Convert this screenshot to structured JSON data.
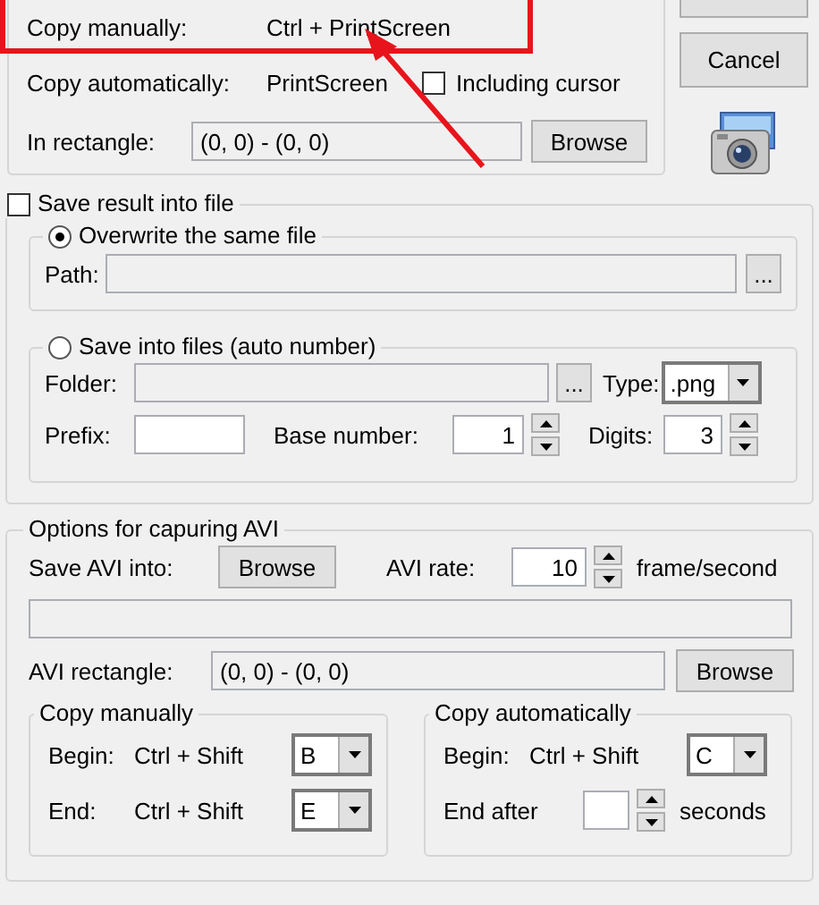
{
  "capture": {
    "copy_manually_label": "Copy manually:",
    "copy_manually_keys": "Ctrl + PrintScreen",
    "copy_auto_label": "Copy automatically:",
    "copy_auto_keys": "PrintScreen",
    "including_cursor": {
      "label": "Including cursor",
      "checked": false
    },
    "rectangle_label": "In rectangle:",
    "rectangle_value": "(0, 0) - (0, 0)",
    "browse": "Browse"
  },
  "cancel": "Cancel",
  "save_file": {
    "label": "Save result into file",
    "checked": false,
    "overwrite": {
      "label": "Overwrite the same file",
      "selected": true,
      "path_label": "Path:",
      "browse": "..."
    },
    "auto": {
      "label": "Save into files (auto number)",
      "selected": false,
      "folder_label": "Folder:",
      "browse": "...",
      "type_label": "Type:",
      "type_value": ".png",
      "prefix_label": "Prefix:",
      "base_label": "Base number:",
      "base_value": "1",
      "digits_label": "Digits:",
      "digits_value": "3"
    }
  },
  "avi": {
    "title": "Options for capuring AVI",
    "save_label": "Save AVI into:",
    "browse": "Browse",
    "rate_label": "AVI rate:",
    "rate_value": "10",
    "rate_unit": "frame/second",
    "rect_label": "AVI rectangle:",
    "rect_value": "(0, 0) - (0, 0)",
    "rect_browse": "Browse",
    "manual": {
      "title": "Copy manually",
      "begin_label": "Begin:",
      "begin_keys": "Ctrl + Shift",
      "begin_key": "B",
      "end_label": "End:",
      "end_keys": "Ctrl + Shift",
      "end_key": "E"
    },
    "auto": {
      "title": "Copy automatically",
      "begin_label": "Begin:",
      "begin_keys": "Ctrl + Shift",
      "begin_key": "C",
      "end_label": "End after",
      "end_unit": "seconds"
    }
  }
}
